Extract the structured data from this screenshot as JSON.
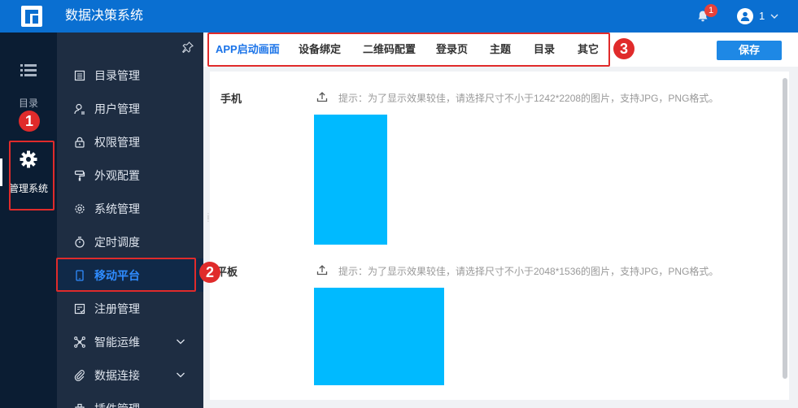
{
  "header": {
    "title": "数据决策系统",
    "notification_count": "1",
    "user_name": "1"
  },
  "rail": {
    "items": [
      {
        "label": "目录"
      },
      {
        "label": "管理系统"
      }
    ]
  },
  "sidebar": {
    "items": [
      {
        "label": "目录管理",
        "icon": "catalog-icon"
      },
      {
        "label": "用户管理",
        "icon": "user-icon"
      },
      {
        "label": "权限管理",
        "icon": "lock-icon"
      },
      {
        "label": "外观配置",
        "icon": "paint-roller-icon"
      },
      {
        "label": "系统管理",
        "icon": "gear-icon"
      },
      {
        "label": "定时调度",
        "icon": "timer-icon"
      },
      {
        "label": "移动平台",
        "icon": "mobile-icon",
        "active": true
      },
      {
        "label": "注册管理",
        "icon": "register-icon"
      },
      {
        "label": "智能运维",
        "icon": "ops-icon",
        "expandable": true
      },
      {
        "label": "数据连接",
        "icon": "link-icon",
        "expandable": true
      },
      {
        "label": "插件管理",
        "icon": "plugin-icon"
      }
    ]
  },
  "tabs": [
    {
      "label": "APP启动画面",
      "active": true
    },
    {
      "label": "设备绑定"
    },
    {
      "label": "二维码配置"
    },
    {
      "label": "登录页"
    },
    {
      "label": "主题"
    },
    {
      "label": "目录"
    },
    {
      "label": "其它"
    }
  ],
  "toolbar": {
    "save_label": "保存"
  },
  "content": {
    "phone": {
      "label": "手机",
      "hint": "提示：为了显示效果较佳，请选择尺寸不小于1242*2208的图片，支持JPG，PNG格式。"
    },
    "tablet": {
      "label": "平板",
      "hint": "提示：为了显示效果较佳，请选择尺寸不小于2048*1536的图片，支持JPG，PNG格式。"
    }
  },
  "annotations": [
    "1",
    "2",
    "3"
  ],
  "colors": {
    "header_bg": "#0a6fd1",
    "rail_bg": "#0b1d33",
    "sidebar_bg": "#1e2d42",
    "accent": "#1a73e8",
    "preview_fill": "#00baff",
    "annotation_red": "#e02b2b"
  }
}
